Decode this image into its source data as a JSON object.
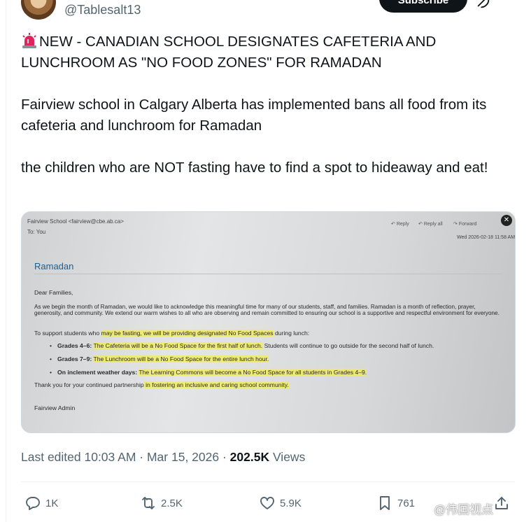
{
  "header": {
    "handle": "@Tablesalt13",
    "subscribe_label": "Subscribe"
  },
  "tweet": {
    "headline": "NEW - CANADIAN SCHOOL DESIGNATES CAFETERIA AND LUNCHROOM AS \"NO FOOD ZONES\" FOR RAMADAN",
    "paragraph1": "Fairview school in Calgary Alberta has implemented bans all food from its cafeteria and lunchroom for Ramadan",
    "paragraph2": "the children who are NOT fasting have to find a spot to hideaway and eat!"
  },
  "email": {
    "from": "Fairview School <fairview@cbe.ab.ca>",
    "to": "To: You",
    "reply": "Reply",
    "reply_all": "Reply all",
    "forward": "Forward",
    "date": "Wed 2026-02-18 11:58 AM",
    "subject": "Ramadan",
    "greeting": "Dear Families,",
    "intro": "As we begin the month of Ramadan, we would like to acknowledge this meaningful time for many of our students, staff, and families. Ramadan is a month of reflection, prayer, generosity, and community. We extend our warm wishes to all who are observing and remain committed to ensuring our school is a supportive and respectful environment for everyone.",
    "support_pre": "To support students who ",
    "support_hl": "may be fasting, we will be providing designated No Food Spaces",
    "support_post": " during lunch:",
    "b1_label": "Grades 4–6:",
    "b1_text": "The Cafeteria will be a No Food Space for the first half of lunch.",
    "b1_tail": " Students will continue to go outside for the second half of lunch.",
    "b2_label": "Grades 7–9:",
    "b2_text": "The Lunchroom will be a No Food Space for the entire lunch hour.",
    "b3_label": "On inclement weather days:",
    "b3_text": "The Learning Commons will become a No Food Space for all students in Grades 4–9.",
    "thanks_pre": "Thank you for your continued partnership",
    "thanks_hl": " in fostering an inclusive and caring school community.",
    "signoff": "Fairview Admin"
  },
  "meta": {
    "edited": "Last edited 10:03 AM · Mar 15, 2026 · ",
    "views_count": "202.5K",
    "views_label": " Views"
  },
  "actions": {
    "replies": "1K",
    "reposts": "2.5K",
    "likes": "5.9K",
    "bookmarks": "761"
  },
  "watermark": "@伟国视点",
  "icons": [
    "siren-icon",
    "grok-icon",
    "reply-icon",
    "repost-icon",
    "like-icon",
    "bookmark-icon",
    "share-icon",
    "close-icon"
  ]
}
